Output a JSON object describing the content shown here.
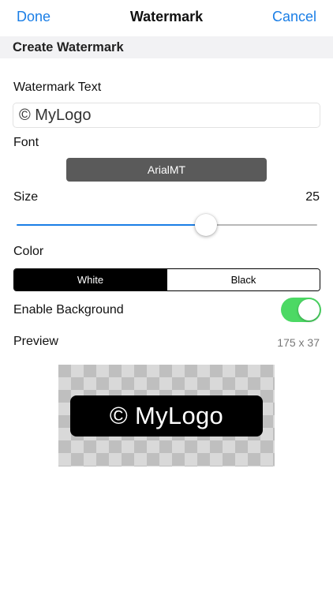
{
  "navbar": {
    "done_label": "Done",
    "title": "Watermark",
    "cancel_label": "Cancel"
  },
  "section": {
    "title": "Create Watermark"
  },
  "watermark_text": {
    "label": "Watermark Text",
    "value": "© MyLogo"
  },
  "font": {
    "label": "Font",
    "selected": "ArialMT"
  },
  "size": {
    "label": "Size",
    "value": "25",
    "slider_fraction": 0.63
  },
  "color": {
    "label": "Color",
    "options": [
      "White",
      "Black"
    ],
    "selected": "White"
  },
  "background": {
    "label": "Enable Background",
    "enabled": true
  },
  "preview": {
    "label": "Preview",
    "dimensions": "175 x 37",
    "watermark_text": "© MyLogo"
  },
  "colors": {
    "accent": "#1a7ee6",
    "toggle_on": "#4cd964",
    "font_button": "#5a5a5a",
    "section_header_bg": "#f2f2f4"
  }
}
